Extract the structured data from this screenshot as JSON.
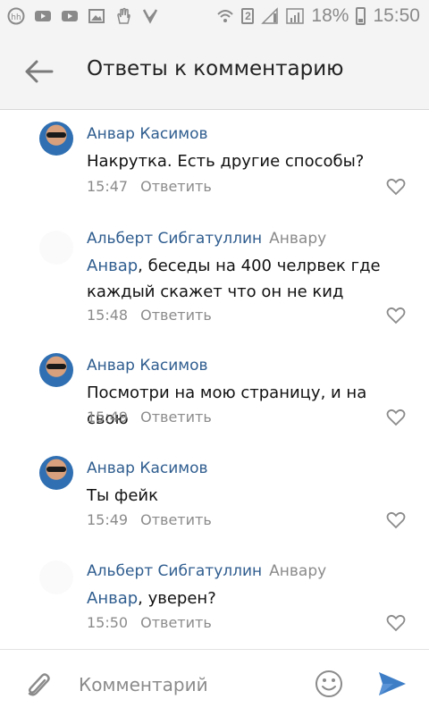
{
  "status_bar": {
    "left_icons": [
      "hh-icon",
      "youtube-icon",
      "youtube-icon",
      "image-icon",
      "hand-icon",
      "check-icon"
    ],
    "sim": "2",
    "battery": "18%",
    "time": "15:50"
  },
  "header": {
    "title": "Ответы к комментарию"
  },
  "comments": [
    {
      "author": "Анвар Касимов",
      "reply_to": "",
      "mention": "",
      "text": "Накрутка. Есть другие способы?",
      "time": "15:47",
      "reply_label": "Ответить"
    },
    {
      "author": "Альберт Сибгатуллин",
      "reply_to": "Анвару",
      "mention": "Анвар",
      "text": ", беседы на 400 челрвек где каждый скажет что он не кид",
      "time": "15:48",
      "reply_label": "Ответить"
    },
    {
      "author": "Анвар Касимов",
      "reply_to": "",
      "mention": "",
      "text": "Посмотри на мою страницу, и на свою",
      "time": "15:49",
      "reply_label": "Ответить"
    },
    {
      "author": "Анвар Касимов",
      "reply_to": "",
      "mention": "",
      "text": "Ты фейк",
      "time": "15:49",
      "reply_label": "Ответить"
    },
    {
      "author": "Альберт Сибгатуллин",
      "reply_to": "Анвару",
      "mention": "Анвар",
      "text": ", уверен?",
      "time": "15:50",
      "reply_label": "Ответить"
    }
  ],
  "composer": {
    "placeholder": "Комментарий"
  },
  "colors": {
    "link": "#2f5d8f",
    "muted": "#8b8b8b",
    "send": "#3e7ec7"
  }
}
